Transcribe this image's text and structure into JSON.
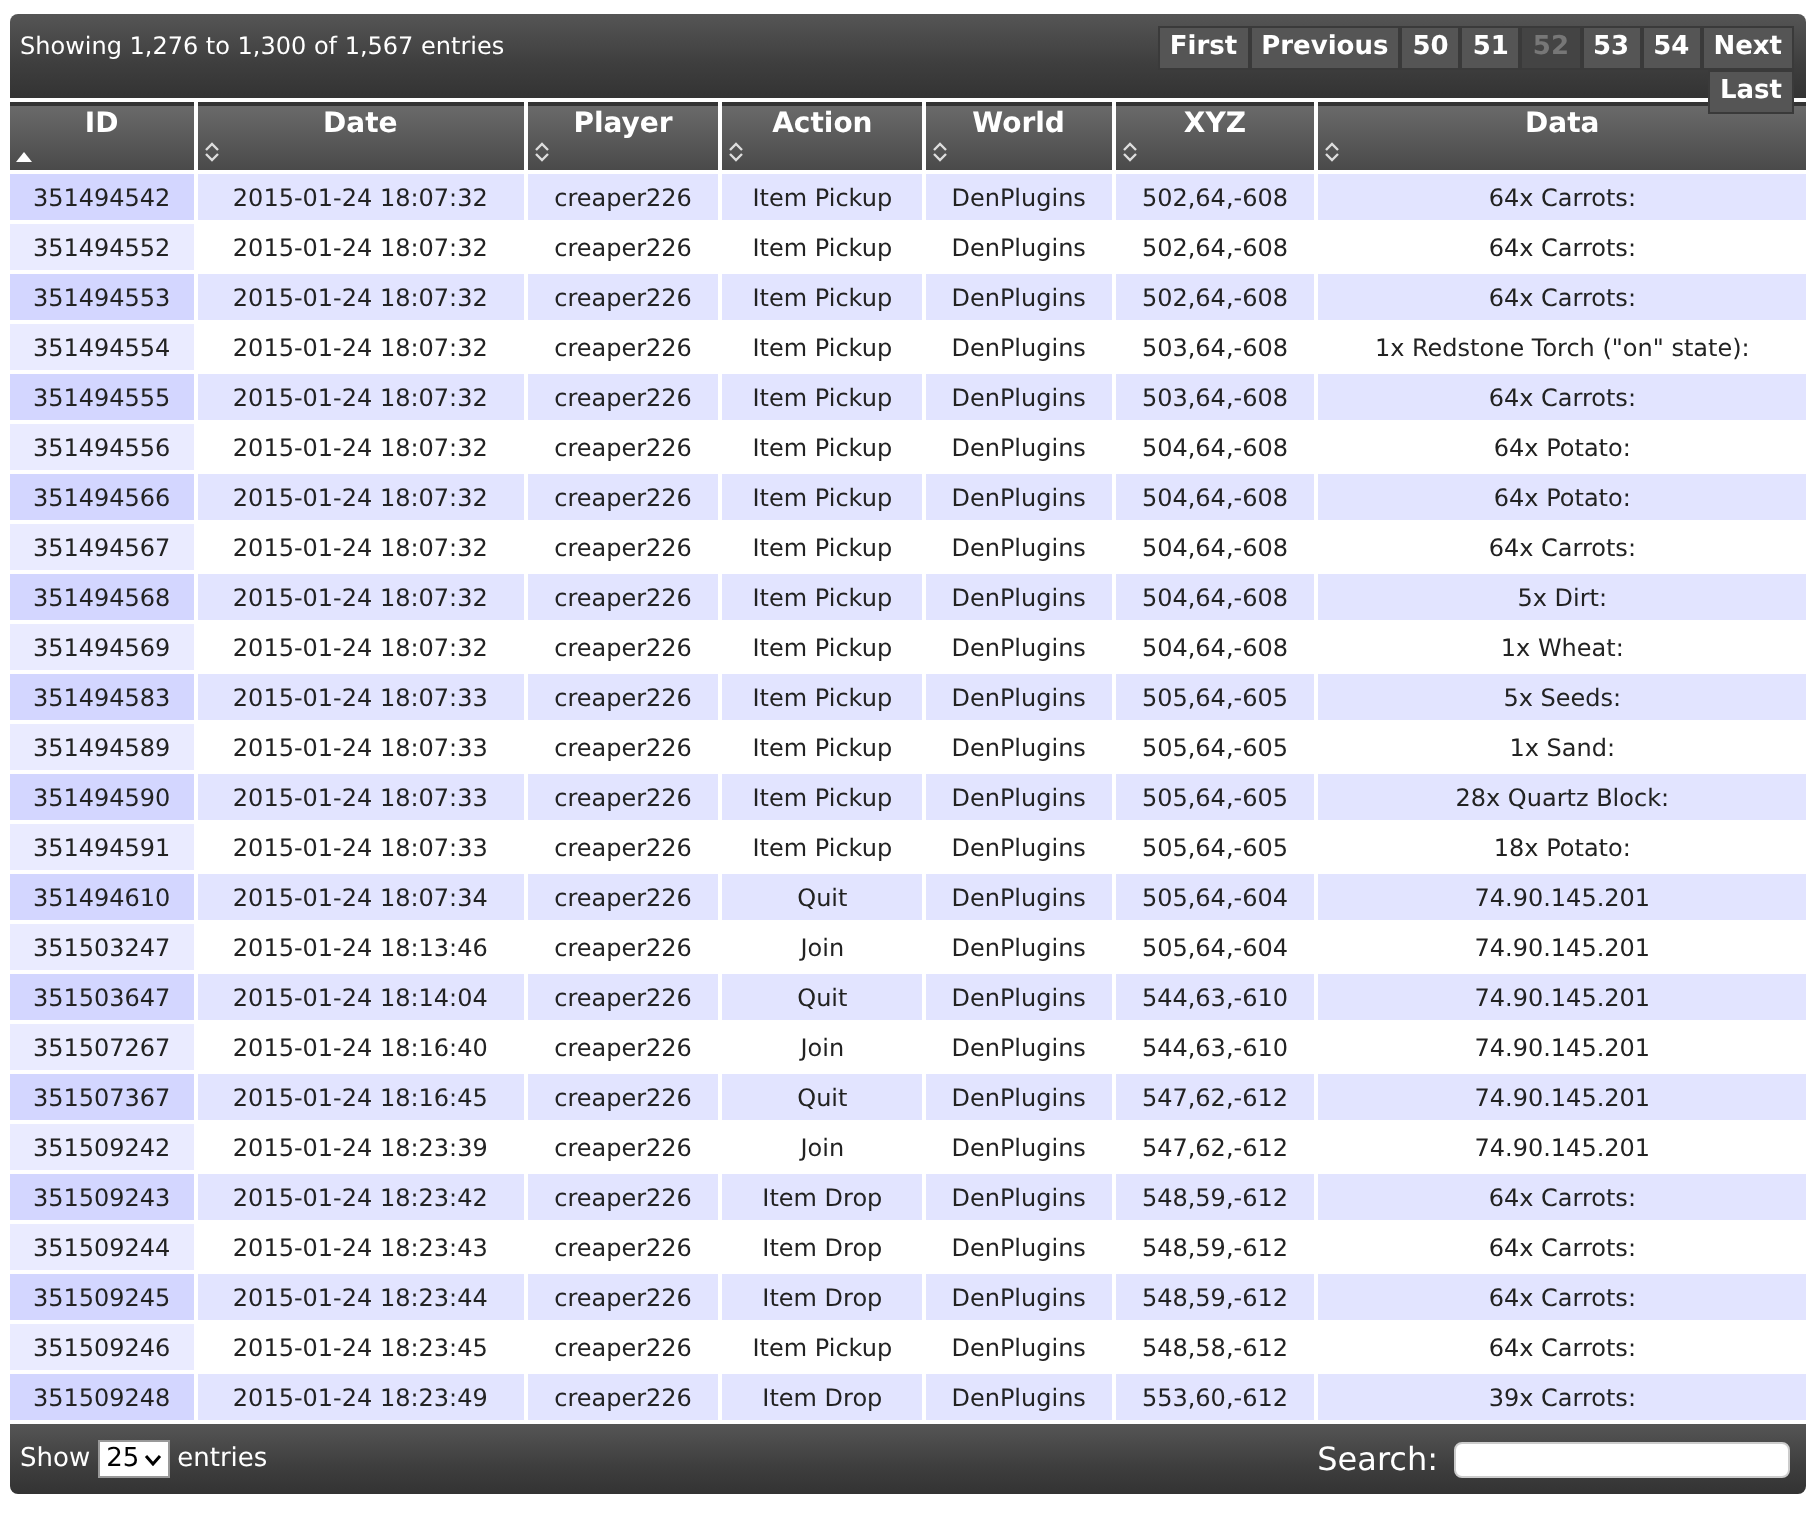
{
  "info": "Showing 1,276 to 1,300 of 1,567 entries",
  "pagination": [
    {
      "label": "First",
      "selected": false
    },
    {
      "label": "Previous",
      "selected": false
    },
    {
      "label": "50",
      "selected": false
    },
    {
      "label": "51",
      "selected": false
    },
    {
      "label": "52",
      "selected": true
    },
    {
      "label": "53",
      "selected": false
    },
    {
      "label": "54",
      "selected": false
    },
    {
      "label": "Next",
      "selected": false
    },
    {
      "label": "Last",
      "selected": false
    }
  ],
  "columns": [
    {
      "label": "ID",
      "sorted": true
    },
    {
      "label": "Date",
      "sorted": false
    },
    {
      "label": "Player",
      "sorted": false
    },
    {
      "label": "Action",
      "sorted": false
    },
    {
      "label": "World",
      "sorted": false
    },
    {
      "label": "XYZ",
      "sorted": false
    },
    {
      "label": "Data",
      "sorted": false
    }
  ],
  "rows": [
    [
      "351494542",
      "2015-01-24 18:07:32",
      "creaper226",
      "Item Pickup",
      "DenPlugins",
      "502,64,-608",
      "64x Carrots:"
    ],
    [
      "351494552",
      "2015-01-24 18:07:32",
      "creaper226",
      "Item Pickup",
      "DenPlugins",
      "502,64,-608",
      "64x Carrots:"
    ],
    [
      "351494553",
      "2015-01-24 18:07:32",
      "creaper226",
      "Item Pickup",
      "DenPlugins",
      "502,64,-608",
      "64x Carrots:"
    ],
    [
      "351494554",
      "2015-01-24 18:07:32",
      "creaper226",
      "Item Pickup",
      "DenPlugins",
      "503,64,-608",
      "1x Redstone Torch (\"on\" state):"
    ],
    [
      "351494555",
      "2015-01-24 18:07:32",
      "creaper226",
      "Item Pickup",
      "DenPlugins",
      "503,64,-608",
      "64x Carrots:"
    ],
    [
      "351494556",
      "2015-01-24 18:07:32",
      "creaper226",
      "Item Pickup",
      "DenPlugins",
      "504,64,-608",
      "64x Potato:"
    ],
    [
      "351494566",
      "2015-01-24 18:07:32",
      "creaper226",
      "Item Pickup",
      "DenPlugins",
      "504,64,-608",
      "64x Potato:"
    ],
    [
      "351494567",
      "2015-01-24 18:07:32",
      "creaper226",
      "Item Pickup",
      "DenPlugins",
      "504,64,-608",
      "64x Carrots:"
    ],
    [
      "351494568",
      "2015-01-24 18:07:32",
      "creaper226",
      "Item Pickup",
      "DenPlugins",
      "504,64,-608",
      "5x Dirt:"
    ],
    [
      "351494569",
      "2015-01-24 18:07:32",
      "creaper226",
      "Item Pickup",
      "DenPlugins",
      "504,64,-608",
      "1x Wheat:"
    ],
    [
      "351494583",
      "2015-01-24 18:07:33",
      "creaper226",
      "Item Pickup",
      "DenPlugins",
      "505,64,-605",
      "5x Seeds:"
    ],
    [
      "351494589",
      "2015-01-24 18:07:33",
      "creaper226",
      "Item Pickup",
      "DenPlugins",
      "505,64,-605",
      "1x Sand:"
    ],
    [
      "351494590",
      "2015-01-24 18:07:33",
      "creaper226",
      "Item Pickup",
      "DenPlugins",
      "505,64,-605",
      "28x Quartz Block:"
    ],
    [
      "351494591",
      "2015-01-24 18:07:33",
      "creaper226",
      "Item Pickup",
      "DenPlugins",
      "505,64,-605",
      "18x Potato:"
    ],
    [
      "351494610",
      "2015-01-24 18:07:34",
      "creaper226",
      "Quit",
      "DenPlugins",
      "505,64,-604",
      "74.90.145.201"
    ],
    [
      "351503247",
      "2015-01-24 18:13:46",
      "creaper226",
      "Join",
      "DenPlugins",
      "505,64,-604",
      "74.90.145.201"
    ],
    [
      "351503647",
      "2015-01-24 18:14:04",
      "creaper226",
      "Quit",
      "DenPlugins",
      "544,63,-610",
      "74.90.145.201"
    ],
    [
      "351507267",
      "2015-01-24 18:16:40",
      "creaper226",
      "Join",
      "DenPlugins",
      "544,63,-610",
      "74.90.145.201"
    ],
    [
      "351507367",
      "2015-01-24 18:16:45",
      "creaper226",
      "Quit",
      "DenPlugins",
      "547,62,-612",
      "74.90.145.201"
    ],
    [
      "351509242",
      "2015-01-24 18:23:39",
      "creaper226",
      "Join",
      "DenPlugins",
      "547,62,-612",
      "74.90.145.201"
    ],
    [
      "351509243",
      "2015-01-24 18:23:42",
      "creaper226",
      "Item Drop",
      "DenPlugins",
      "548,59,-612",
      "64x Carrots:"
    ],
    [
      "351509244",
      "2015-01-24 18:23:43",
      "creaper226",
      "Item Drop",
      "DenPlugins",
      "548,59,-612",
      "64x Carrots:"
    ],
    [
      "351509245",
      "2015-01-24 18:23:44",
      "creaper226",
      "Item Drop",
      "DenPlugins",
      "548,59,-612",
      "64x Carrots:"
    ],
    [
      "351509246",
      "2015-01-24 18:23:45",
      "creaper226",
      "Item Pickup",
      "DenPlugins",
      "548,58,-612",
      "64x Carrots:"
    ],
    [
      "351509248",
      "2015-01-24 18:23:49",
      "creaper226",
      "Item Drop",
      "DenPlugins",
      "553,60,-612",
      "39x Carrots:"
    ]
  ],
  "length": {
    "label_before": "Show",
    "value": "25",
    "label_after": "entries"
  },
  "search": {
    "label": "Search:"
  }
}
